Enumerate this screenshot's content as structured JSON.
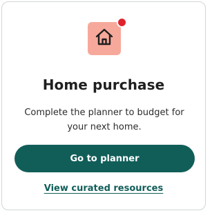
{
  "card": {
    "icon": "home-icon",
    "notification_indicator": true,
    "title": "Home purchase",
    "description": "Complete the planner to budget for your next home.",
    "primary_button_label": "Go to planner",
    "secondary_link_label": "View curated resources"
  },
  "colors": {
    "accent": "#115e59",
    "icon_background": "#f6a99a",
    "notification": "#e0222b",
    "text": "#1f1f1f"
  }
}
